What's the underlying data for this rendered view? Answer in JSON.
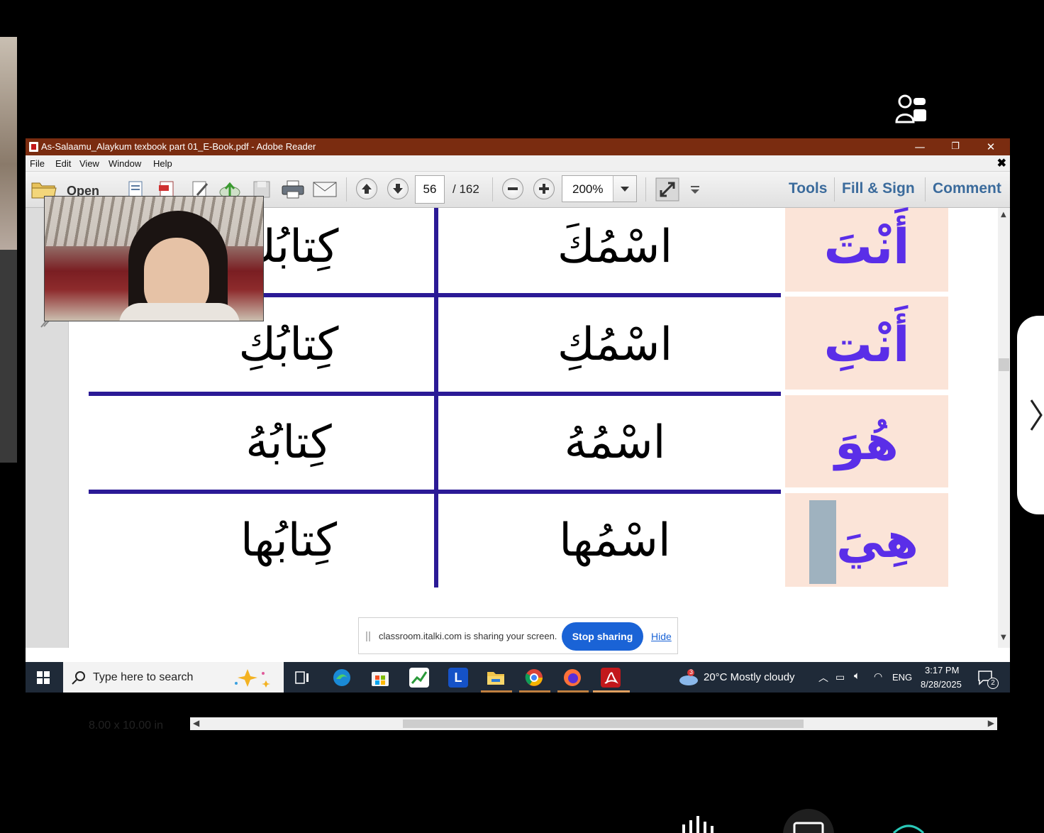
{
  "window": {
    "title": "As-Salaamu_Alaykum texbook part 01_E-Book.pdf - Adobe Reader",
    "minimize": "—",
    "restore": "❐",
    "close": "✕"
  },
  "menu": {
    "items": [
      "File",
      "Edit",
      "View",
      "Window",
      "Help"
    ],
    "close_doc": "✖"
  },
  "toolbar": {
    "open_label": "Open",
    "current_page": "56",
    "total_pages": "/ 162",
    "zoom": "200%",
    "tools": "Tools",
    "fill_sign": "Fill & Sign",
    "comment": "Comment"
  },
  "table": {
    "rows": [
      {
        "pronoun": "أَنْتَ",
        "name": "اسْمُكَ",
        "book": "كِتابُكَ"
      },
      {
        "pronoun": "أَنْتِ",
        "name": "اسْمُكِ",
        "book": "كِتابُكِ"
      },
      {
        "pronoun": "هُوَ",
        "name": "اسْمُهُ",
        "book": "كِتابُهُ"
      },
      {
        "pronoun": "هِيَ",
        "name": "اسْمُها",
        "book": "كِتابُها"
      }
    ]
  },
  "status": {
    "page_size": "8.00 x 10.00 in"
  },
  "share_bar": {
    "message": "classroom.italki.com is sharing your screen.",
    "stop_label": "Stop sharing",
    "hide_label": "Hide"
  },
  "taskbar": {
    "search_placeholder": "Type here to search",
    "weather": "20°C  Mostly cloudy",
    "language": "ENG",
    "time": "3:17 PM",
    "date": "8/28/2025",
    "notification_count": "2",
    "weather_badge": "3"
  },
  "colors": {
    "title_bar": "#7a2c10",
    "table_line": "#2b1a96",
    "pronoun_text": "#5a2ee8",
    "pronoun_cell": "#fbe4d8",
    "stop_button": "#1a63d6"
  }
}
